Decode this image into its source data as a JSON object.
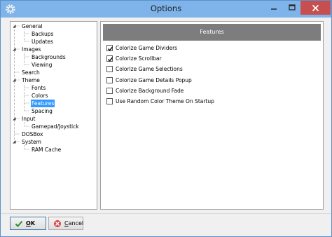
{
  "window": {
    "title": "Options"
  },
  "tree": {
    "items": [
      {
        "label": "General",
        "expanded": true
      },
      {
        "label": "Backups"
      },
      {
        "label": "Updates"
      },
      {
        "label": "Images",
        "expanded": true
      },
      {
        "label": "Backgrounds"
      },
      {
        "label": "Viewing"
      },
      {
        "label": "Search"
      },
      {
        "label": "Theme",
        "expanded": true
      },
      {
        "label": "Fonts"
      },
      {
        "label": "Colors"
      },
      {
        "label": "Features",
        "selected": true
      },
      {
        "label": "Spacing"
      },
      {
        "label": "Input",
        "expanded": true
      },
      {
        "label": "Gamepad/Joystick"
      },
      {
        "label": "DOSBox"
      },
      {
        "label": "System",
        "expanded": true
      },
      {
        "label": "RAM Cache"
      }
    ]
  },
  "panel": {
    "header": "Features",
    "options": [
      {
        "label": "Colorize Game Dividers",
        "checked": true
      },
      {
        "label": "Colorize Scrollbar",
        "checked": true
      },
      {
        "label": "Colorize Game Selections",
        "checked": false
      },
      {
        "label": "Colorize Game Details Popup",
        "checked": false
      },
      {
        "label": "Colorize Background Fade",
        "checked": false
      },
      {
        "label": "Use Random Color Theme On Startup",
        "checked": false
      }
    ]
  },
  "buttons": {
    "ok_accel": "O",
    "ok_rest": "K",
    "cancel_accel": "C",
    "cancel_rest": "ancel"
  },
  "colors": {
    "titlebar": "#7eb4ea",
    "close": "#c74f50",
    "selection": "#3399ff",
    "panel_header": "#7d7d7d"
  },
  "icons": {
    "app": "gear-icon",
    "ok": "check-icon",
    "cancel": "cancel-icon"
  }
}
